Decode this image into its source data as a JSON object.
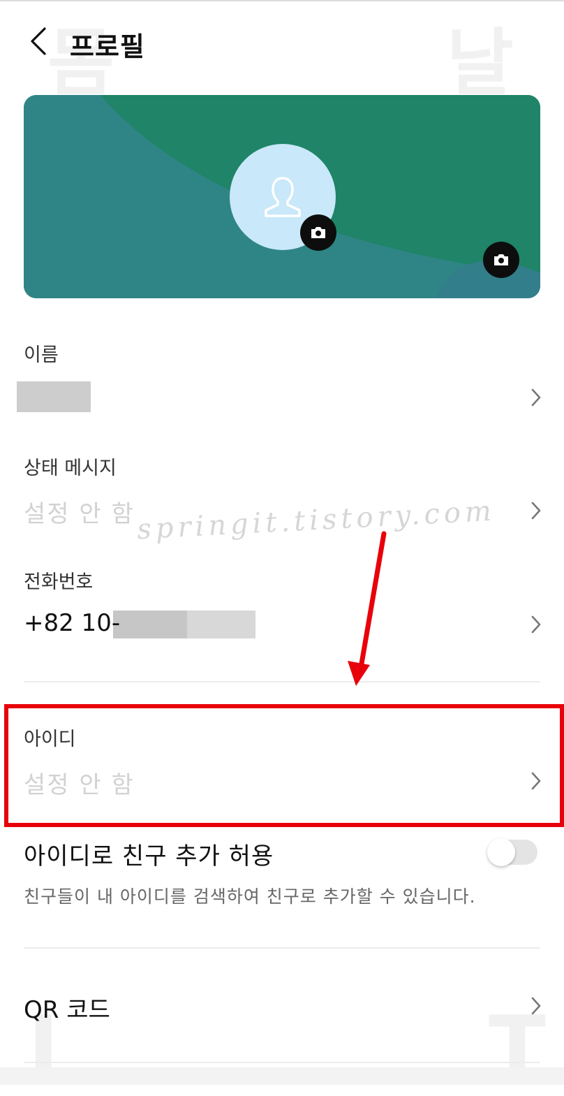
{
  "header": {
    "title": "프로필"
  },
  "background_text": {
    "left_top": "몸",
    "right_top": "날",
    "left_bottom": "I",
    "right_bottom": "T"
  },
  "banner": {
    "bg_color": "#2f8585",
    "accent_color": "#1f8468"
  },
  "profile": {
    "name": {
      "label": "이름",
      "value": ""
    },
    "status": {
      "label": "상태 메시지",
      "value": "설정 안 함"
    },
    "phone": {
      "label": "전화번호",
      "value": "+82 10-"
    },
    "id": {
      "label": "아이디",
      "value": "설정 안 함"
    },
    "allow_id_search": {
      "label": "아이디로 친구 추가 허용",
      "description": "친구들이 내 아이디를 검색하여 친구로 추가할 수 있습니다.",
      "enabled": false
    },
    "qr": {
      "label": "QR 코드"
    }
  },
  "watermark": "springit.tistory.com",
  "colors": {
    "highlight": "#e8000a",
    "placeholder_text": "#d2d2d2"
  }
}
